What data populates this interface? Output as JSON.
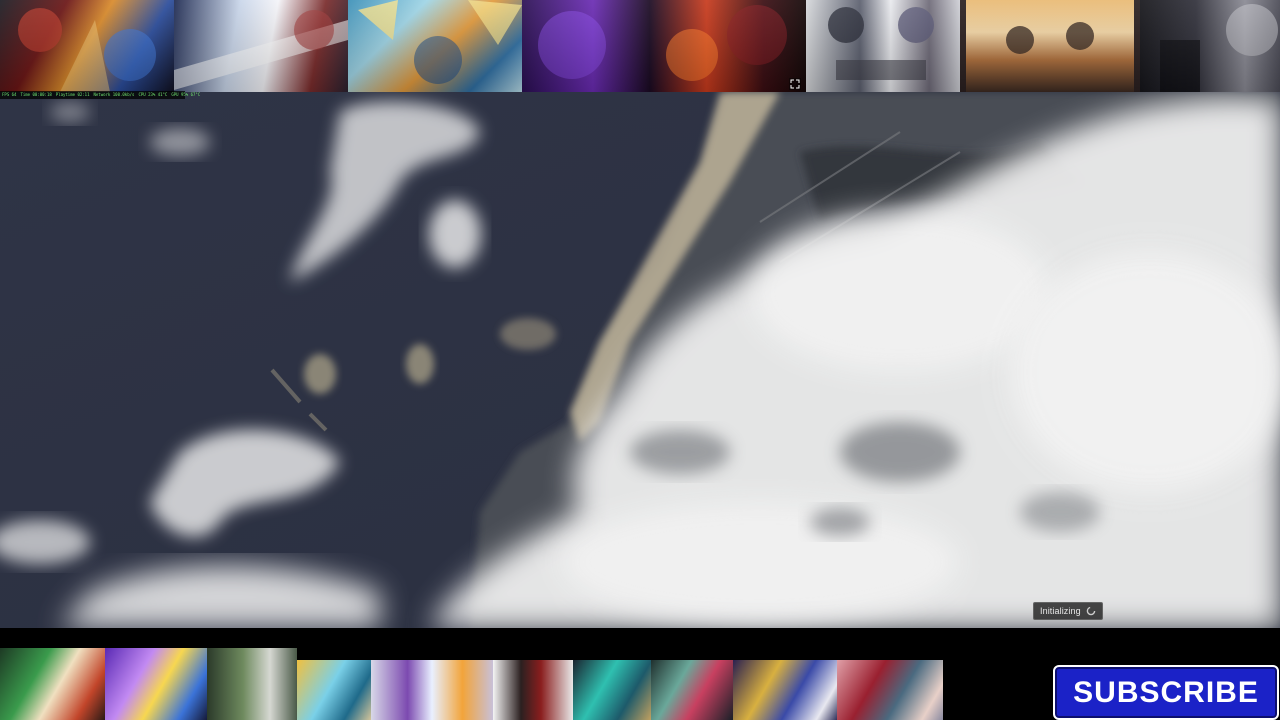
{
  "stats": {
    "fps": "FPS 64",
    "time": "Time 00:00:18",
    "playtime": "Playtime 02:11",
    "network": "Network 100.0kb/s",
    "cpu": "CPU 23% 41°C",
    "gpu": "GPU 95% 67°C"
  },
  "status": {
    "initializing_label": "Initializing"
  },
  "subscribe": {
    "label": "SUBSCRIBE",
    "color": "#1b22c7"
  },
  "colors": {
    "ocean": "#2d3243",
    "cloud": "#f2f2f2",
    "background": "#000000"
  },
  "top_thumbnails": [
    "thumbnail-anime-fight-red",
    "thumbnail-anime-battle-blue",
    "thumbnail-super-saiyan",
    "thumbnail-purple-aura",
    "thumbnail-red-fire",
    "thumbnail-chess-scene",
    "thumbnail-sunset-duo",
    "thumbnail-dark-moon"
  ],
  "bottom_thumbnails": [
    "thumbnail-hero-green",
    "thumbnail-lightning-purple",
    "thumbnail-hunter-duo",
    "thumbnail-blue-flame",
    "thumbnail-saiyan-clash",
    "thumbnail-samurai",
    "thumbnail-swordsman-teal",
    "thumbnail-crowd-fight",
    "thumbnail-mech-knight",
    "thumbnail-red-kimono"
  ]
}
